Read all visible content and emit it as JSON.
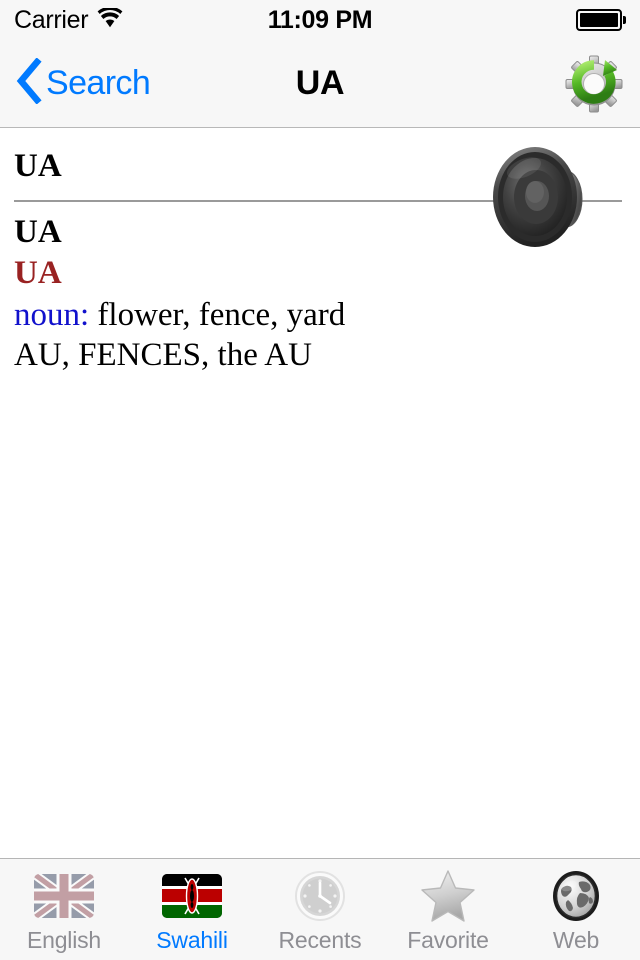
{
  "status_bar": {
    "carrier": "Carrier",
    "wifi_icon": "wifi-icon",
    "time": "11:09 PM",
    "battery_icon": "battery-full-icon"
  },
  "nav_bar": {
    "back_icon": "chevron-left-icon",
    "back_label": "Search",
    "title": "UA",
    "right_action_icon": "gear-refresh-icon"
  },
  "entry": {
    "headword": "UA",
    "speaker_icon": "speaker-icon",
    "term_main": "UA",
    "term_alt": "UA",
    "pos_label": "noun:",
    "definitions": " flower, fence, yard",
    "translations": "AU, FENCES, the AU"
  },
  "tabs": [
    {
      "label": "English",
      "icon": "uk-flag-icon",
      "active": false
    },
    {
      "label": "Swahili",
      "icon": "kenya-flag-icon",
      "active": true
    },
    {
      "label": "Recents",
      "icon": "clock-icon",
      "active": false
    },
    {
      "label": "Favorite",
      "icon": "star-icon",
      "active": false
    },
    {
      "label": "Web",
      "icon": "globe-icon",
      "active": false
    }
  ],
  "colors": {
    "ios_blue": "#007aff",
    "term_alt_red": "#992222",
    "pos_blue": "#1111cc",
    "bar_background": "#f7f7f7",
    "inactive_label": "#8e8e93"
  }
}
